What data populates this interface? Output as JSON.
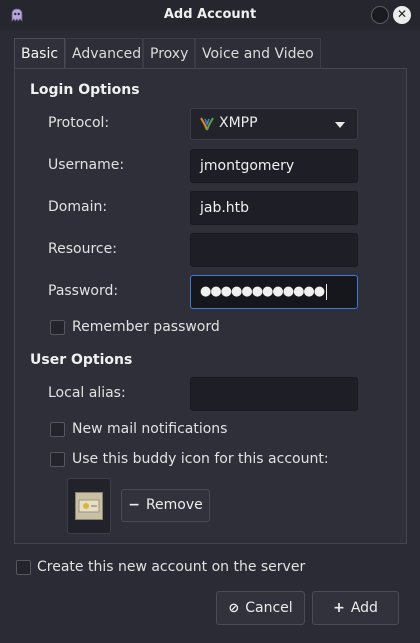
{
  "window": {
    "title": "Add Account"
  },
  "tabs": [
    {
      "label": "Basic"
    },
    {
      "label": "Advanced"
    },
    {
      "label": "Proxy"
    },
    {
      "label": "Voice and Video"
    }
  ],
  "login_options": {
    "title": "Login Options",
    "protocol": {
      "label": "Protocol:",
      "value": "XMPP",
      "icon": "xmpp-icon"
    },
    "username": {
      "label": "Username:",
      "value": "jmontgomery"
    },
    "domain": {
      "label": "Domain:",
      "value": "jab.htb"
    },
    "resource": {
      "label": "Resource:",
      "value": ""
    },
    "password": {
      "label": "Password:",
      "value": "●●●●●●●●●●●●"
    },
    "remember": {
      "label": "Remember password",
      "checked": false
    }
  },
  "user_options": {
    "title": "User Options",
    "local_alias": {
      "label": "Local alias:",
      "value": ""
    },
    "new_mail": {
      "label": "New mail notifications",
      "checked": false
    },
    "buddy_icon": {
      "label": "Use this buddy icon for this account:",
      "checked": false
    },
    "remove_button": "Remove"
  },
  "create_account": {
    "label": "Create this new account on the server",
    "checked": false
  },
  "buttons": {
    "cancel": "Cancel",
    "add": "Add"
  },
  "colors": {
    "accent": "#3d7bd9",
    "background": "#2a2b34",
    "field": "#1e1f26"
  }
}
